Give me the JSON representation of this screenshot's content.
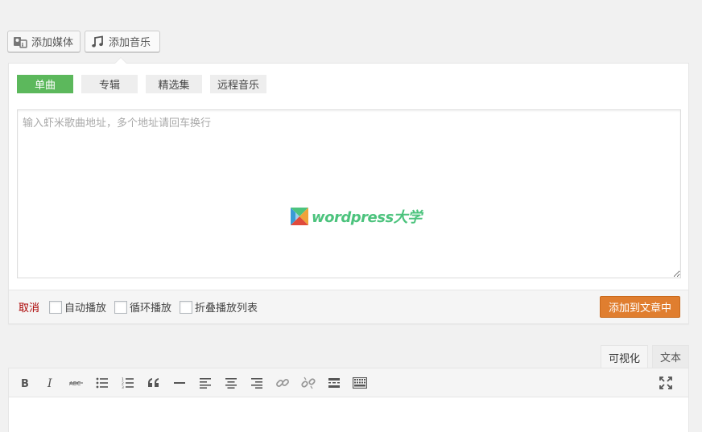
{
  "media_buttons": {
    "add_media": "添加媒体",
    "add_music": "添加音乐"
  },
  "music_panel": {
    "tabs": [
      {
        "label": "单曲",
        "active": true
      },
      {
        "label": "专辑",
        "active": false
      },
      {
        "label": "精选集",
        "active": false
      },
      {
        "label": "远程音乐",
        "active": false
      }
    ],
    "textarea_placeholder": "输入虾米歌曲地址，多个地址请回车换行",
    "watermark_text": "wordpress大学",
    "footer": {
      "cancel": "取消",
      "options": [
        "自动播放",
        "循环播放",
        "折叠播放列表"
      ],
      "insert_button": "添加到文章中"
    }
  },
  "editor": {
    "tabs": [
      {
        "label": "可视化",
        "active": true
      },
      {
        "label": "文本",
        "active": false
      }
    ],
    "toolbar": [
      "bold-icon",
      "italic-icon",
      "strikethrough-icon",
      "bullet-list-icon",
      "numbered-list-icon",
      "blockquote-icon",
      "horizontal-rule-icon",
      "align-left-icon",
      "align-center-icon",
      "align-right-icon",
      "link-icon",
      "unlink-icon",
      "read-more-icon",
      "toolbar-toggle-icon",
      "fullscreen-icon"
    ]
  },
  "colors": {
    "active_tab": "#5cb85c",
    "insert_button": "#e07e2f",
    "cancel": "#aa0000",
    "watermark": "#4cc37d"
  }
}
